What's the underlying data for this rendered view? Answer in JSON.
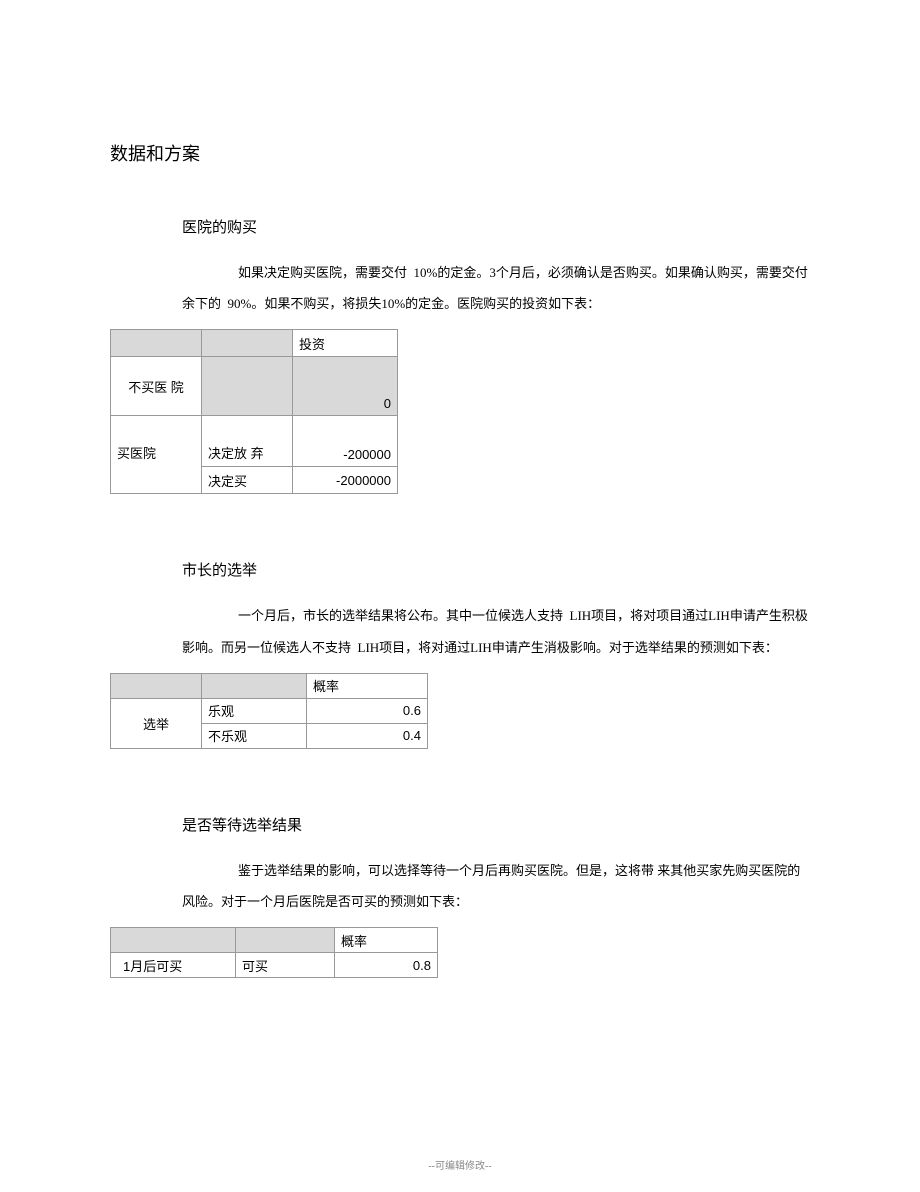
{
  "title": "数据和方案",
  "section1": {
    "heading": "医院的购买",
    "para": "如果决定购买医院，需要交付 10%的定金。3个月后，必须确认是否购买。如果确认购买，需要交付余下的 90%。如果不购买，将损失10%的定金。医院购买的投资如下表：",
    "table": {
      "col_header": "投资",
      "row1_label": "不买医 院",
      "row1_value": "0",
      "row2_label": "买医院",
      "row2_sub1": "决定放 弃",
      "row2_val1": "-200000",
      "row2_sub2": "决定买",
      "row2_val2": "-2000000"
    }
  },
  "section2": {
    "heading": "市长的选举",
    "para": "一个月后，市长的选举结果将公布。其中一位候选人支持 LIH项目，将对项目通过LIH申请产生积极影响。而另一位候选人不支持 LIH项目，将对通过LIH申请产生消极影响。对于选举结果的预测如下表：",
    "table": {
      "col_header": "概率",
      "row_label": "选举",
      "sub1": "乐观",
      "val1": "0.6",
      "sub2": "不乐观",
      "val2": "0.4"
    }
  },
  "section3": {
    "heading": "是否等待选举结果",
    "para": "鉴于选举结果的影响，可以选择等待一个月后再购买医院。但是，这将带 来其他买家先购买医院的风险。对于一个月后医院是否可买的预测如下表：",
    "table": {
      "col_header": "概率",
      "row_label": "1月后可买",
      "sub1": "可买",
      "val1": "0.8"
    }
  },
  "footer": "--可编辑修改--",
  "chart_data": [
    {
      "type": "table",
      "title": "医院的购买 投资",
      "rows": [
        {
          "decision": "不买医院",
          "sub": null,
          "投资": 0
        },
        {
          "decision": "买医院",
          "sub": "决定放弃",
          "投资": -200000
        },
        {
          "decision": "买医院",
          "sub": "决定买",
          "投资": -2000000
        }
      ]
    },
    {
      "type": "table",
      "title": "市长的选举 概率",
      "rows": [
        {
          "event": "选举",
          "outcome": "乐观",
          "概率": 0.6
        },
        {
          "event": "选举",
          "outcome": "不乐观",
          "概率": 0.4
        }
      ]
    },
    {
      "type": "table",
      "title": "1月后可买 概率",
      "rows": [
        {
          "event": "1月后可买",
          "outcome": "可买",
          "概率": 0.8
        }
      ]
    }
  ]
}
